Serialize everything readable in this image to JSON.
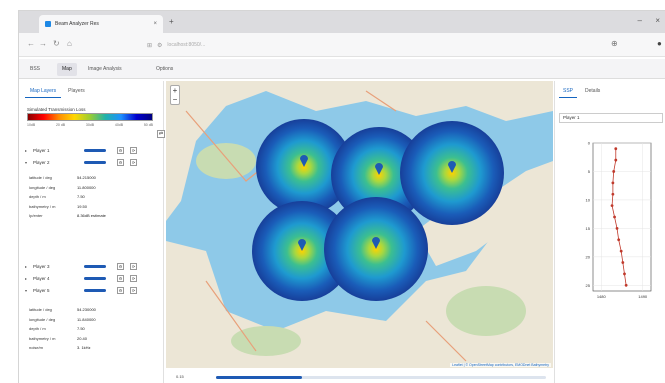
{
  "browser": {
    "tab_title": "Beam Analyzer Res",
    "tab_close": "×",
    "new_tab": "+",
    "minimize": "–",
    "close": "×",
    "nav_back": "←",
    "nav_forward": "→",
    "nav_reload": "↻",
    "nav_home": "⌂",
    "address": "localhost:8050/...",
    "addr_icons": [
      "⊞",
      "⚙"
    ]
  },
  "app_tabs": [
    "BSS",
    "Map",
    "Image Analysis",
    "Options"
  ],
  "left_panel": {
    "tabs": [
      "Map Layers",
      "Players"
    ],
    "colorbar_label": "Simulated Transmission Loss",
    "colorbar_button": "⇄",
    "colorbar_ticks": [
      "10dB",
      "20 dB",
      "30dB",
      "40dB",
      "50 dB"
    ],
    "player_buttons": [
      "⚙",
      "⟳"
    ],
    "players": [
      {
        "name": "Player 1",
        "expanded": false
      },
      {
        "name": "Player 2",
        "expanded": true
      },
      {
        "name": "Player 3",
        "expanded": false
      },
      {
        "name": "Player 4",
        "expanded": false
      },
      {
        "name": "Player 5",
        "expanded": true
      }
    ],
    "details_p2": [
      {
        "key": "latitude / deg",
        "value": "54.215000"
      },
      {
        "key": "longitude / deg",
        "value": "11.800000"
      },
      {
        "key": "depth / m",
        "value": "7.50"
      },
      {
        "key": "bathymetry / m",
        "value": "19.50"
      },
      {
        "key": "Ip/enter",
        "value": "8.36dB estimate"
      }
    ],
    "details_p5": [
      {
        "key": "latitude / deg",
        "value": "54.230000"
      },
      {
        "key": "longitude / deg",
        "value": "11.840000"
      },
      {
        "key": "depth / m",
        "value": "7.50"
      },
      {
        "key": "bathymetry / m",
        "value": "20.40"
      },
      {
        "key": "noise/m",
        "value": "3. 1kHz"
      }
    ]
  },
  "map": {
    "zoom_in": "+",
    "zoom_out": "−",
    "attribution": "Leaflet | © OpenStreetMap contributors, EMODnet Bathymetry",
    "colors": {
      "sea": "#8ec9e8",
      "land": "#ece6d6",
      "forest": "#c8dcb2",
      "road": "#e8a07a",
      "marker": "#1e5ab4"
    }
  },
  "time_slider": {
    "label": "0.15",
    "progress": 0.26
  },
  "right_panel": {
    "tabs": [
      "SSP",
      "Details"
    ],
    "selected_player": "Player 1"
  },
  "chart_data": {
    "type": "line",
    "title": "",
    "xlabel": "",
    "ylabel": "",
    "x_ticks": [
      "1480",
      "1490"
    ],
    "y_ticks": [
      "0",
      "5",
      "10",
      "15",
      "20",
      "25"
    ],
    "series": [
      {
        "values": [
          {
            "x": 1483.5,
            "y": 1
          },
          {
            "x": 1483.5,
            "y": 3
          },
          {
            "x": 1483.0,
            "y": 5
          },
          {
            "x": 1482.8,
            "y": 7
          },
          {
            "x": 1482.8,
            "y": 9
          },
          {
            "x": 1482.6,
            "y": 11
          },
          {
            "x": 1483.2,
            "y": 13
          },
          {
            "x": 1483.8,
            "y": 15
          },
          {
            "x": 1484.2,
            "y": 17
          },
          {
            "x": 1484.8,
            "y": 19
          },
          {
            "x": 1485.2,
            "y": 21
          },
          {
            "x": 1485.6,
            "y": 23
          },
          {
            "x": 1486.0,
            "y": 25
          }
        ]
      }
    ],
    "xlim": [
      1478,
      1492
    ],
    "ylim": [
      0,
      26
    ],
    "y_inverted": true,
    "grid": true,
    "color": "#c0392b"
  }
}
